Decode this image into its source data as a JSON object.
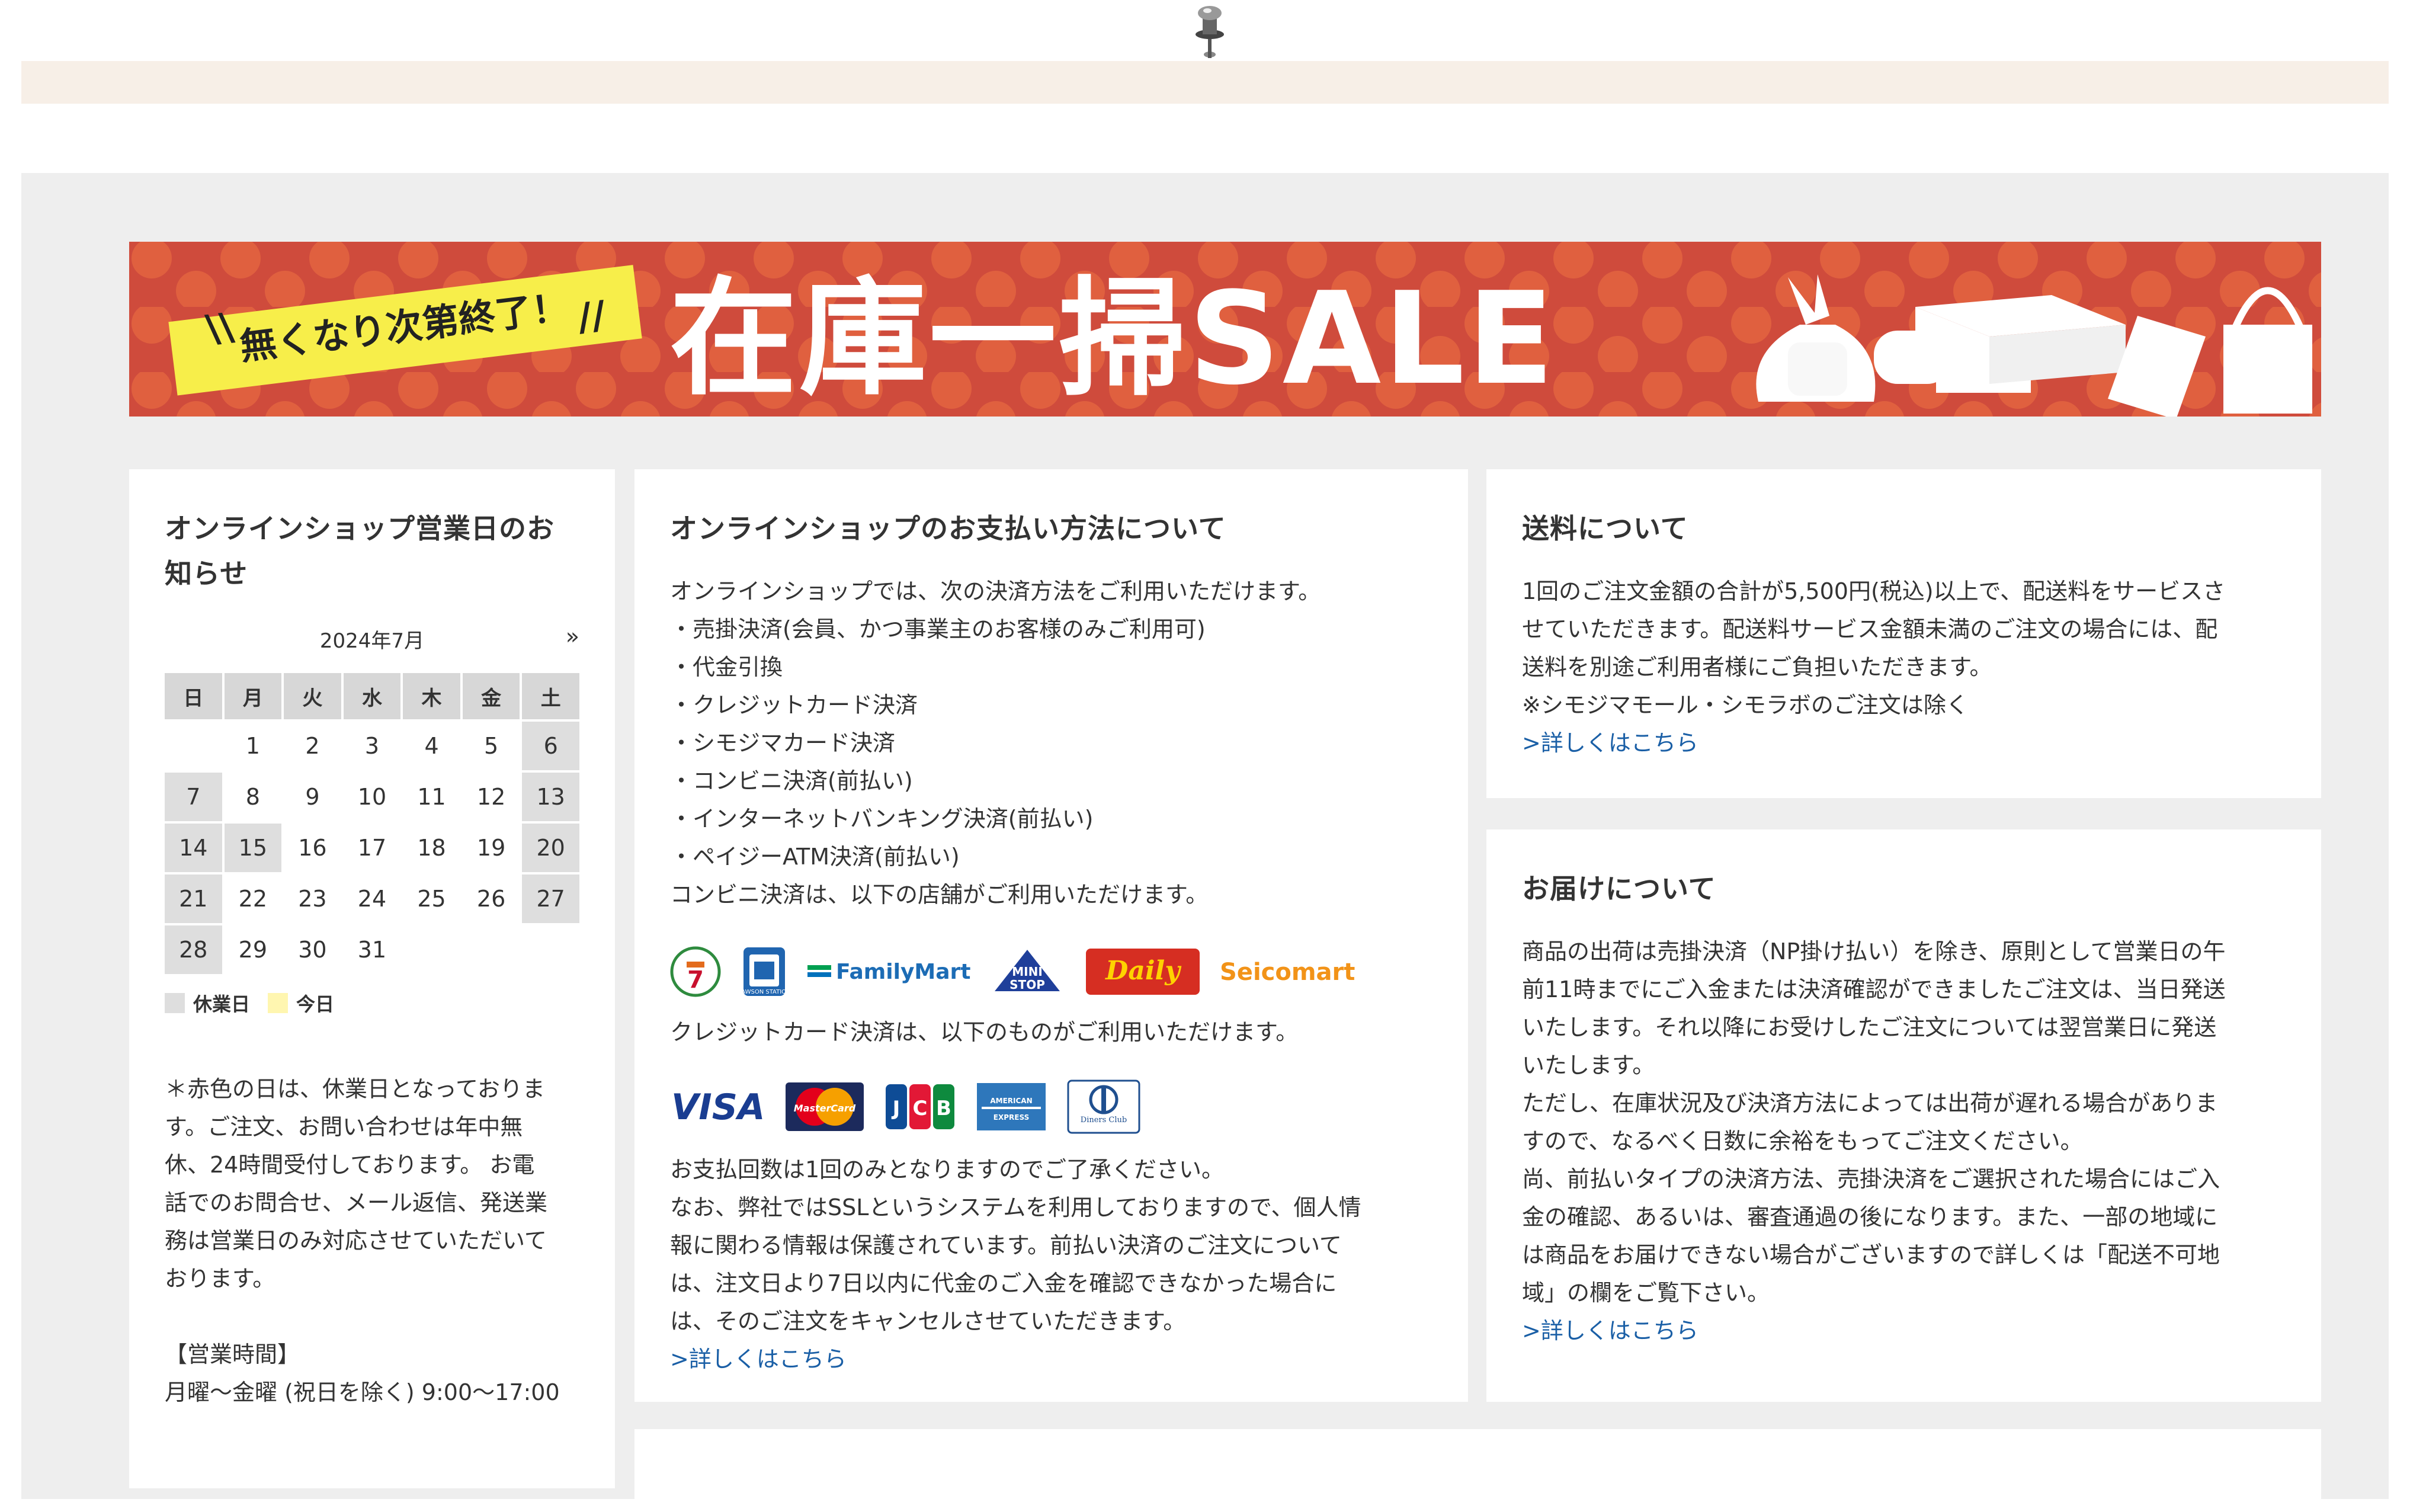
{
  "banner": {
    "tag_text": "無くなり次第終了！",
    "title": "在庫一掃SALE",
    "colors": {
      "background": "#cf4b3c",
      "dots": "#e0603f",
      "tag": "#f7ee4a"
    }
  },
  "calendar_card": {
    "title": "オンラインショップ営業日のお知らせ",
    "month": "2024年7月",
    "next": "»",
    "weekdays": [
      "日",
      "月",
      "火",
      "水",
      "木",
      "金",
      "土"
    ],
    "weeks": [
      [
        {
          "d": "",
          "off": false
        },
        {
          "d": "1",
          "off": false
        },
        {
          "d": "2",
          "off": false
        },
        {
          "d": "3",
          "off": false
        },
        {
          "d": "4",
          "off": false
        },
        {
          "d": "5",
          "off": false
        },
        {
          "d": "6",
          "off": true
        }
      ],
      [
        {
          "d": "7",
          "off": true
        },
        {
          "d": "8",
          "off": false
        },
        {
          "d": "9",
          "off": false
        },
        {
          "d": "10",
          "off": false
        },
        {
          "d": "11",
          "off": false
        },
        {
          "d": "12",
          "off": false
        },
        {
          "d": "13",
          "off": true
        }
      ],
      [
        {
          "d": "14",
          "off": true
        },
        {
          "d": "15",
          "off": true
        },
        {
          "d": "16",
          "off": false
        },
        {
          "d": "17",
          "off": false
        },
        {
          "d": "18",
          "off": false
        },
        {
          "d": "19",
          "off": false
        },
        {
          "d": "20",
          "off": true
        }
      ],
      [
        {
          "d": "21",
          "off": true
        },
        {
          "d": "22",
          "off": false
        },
        {
          "d": "23",
          "off": false
        },
        {
          "d": "24",
          "off": false
        },
        {
          "d": "25",
          "off": false
        },
        {
          "d": "26",
          "off": false
        },
        {
          "d": "27",
          "off": true
        }
      ],
      [
        {
          "d": "28",
          "off": true
        },
        {
          "d": "29",
          "off": false
        },
        {
          "d": "30",
          "off": false
        },
        {
          "d": "31",
          "off": false
        },
        {
          "d": "",
          "off": false
        },
        {
          "d": "",
          "off": false
        },
        {
          "d": "",
          "off": false
        }
      ]
    ],
    "legend_holiday": "休業日",
    "legend_today": "今日",
    "note_lines": [
      "＊赤色の日は、休業日となっておりま",
      "す。ご注文、お問い合わせは年中無",
      "休、24時間受付しております。 お電",
      "話でのお問合せ、メール返信、発送業",
      "務は営業日のみ対応させていただいて",
      "おります。"
    ],
    "hours_label": "【営業時間】",
    "hours_text": "月曜〜金曜 (祝日を除く) 9:00〜17:00"
  },
  "payment_card": {
    "title": "オンラインショップのお支払い方法について",
    "intro_lines": [
      "オンラインショップでは、次の決済方法をご利用いただけます。",
      "・売掛決済(会員、かつ事業主のお客様のみご利用可)",
      "・代金引換",
      "・クレジットカード決済",
      "・シモジマカード決済",
      "・コンビニ決済(前払い)",
      "・インターネットバンキング決済(前払い)",
      "・ペイジーATM決済(前払い)",
      "コンビニ決済は、以下の店舗がご利用いただけます。"
    ],
    "store_logos": [
      "7-Eleven",
      "LAWSON STATION",
      "FamilyMart",
      "MINI STOP",
      "Daily YAMAZAKI",
      "Seicomart"
    ],
    "credit_line": "クレジットカード決済は、以下のものがご利用いただけます。",
    "card_logos": [
      "VISA",
      "MasterCard",
      "JCB",
      "AMERICAN EXPRESS",
      "Diners Club INTERNATIONAL"
    ],
    "footer_lines": [
      "お支払回数は1回のみとなりますのでご了承ください。",
      "なお、弊社ではSSLというシステムを利用しておりますので、個人情",
      "報に関わる情報は保護されています。前払い決済のご注文について",
      "は、注文日より7日以内に代金のご入金を確認できなかった場合に",
      "は、そのご注文をキャンセルさせていただきます。"
    ],
    "link": ">詳しくはこちら"
  },
  "shipping_card": {
    "title": "送料について",
    "lines": [
      "1回のご注文金額の合計が5,500円(税込)以上で、配送料をサービスさ",
      "せていただきます。配送料サービス金額未満のご注文の場合には、配",
      "送料を別途ご利用者様にご負担いただきます。",
      "※シモジマモール・シモラボのご注文は除く"
    ],
    "link": ">詳しくはこちら"
  },
  "delivery_card": {
    "title": "お届けについて",
    "lines": [
      "商品の出荷は売掛決済（NP掛け払い）を除き、原則として営業日の午",
      "前11時までにご入金または決済確認ができましたご注文は、当日発送",
      "いたします。それ以降にお受けしたご注文については翌営業日に発送",
      "いたします。",
      "ただし、在庫状況及び決済方法によっては出荷が遅れる場合がありま",
      "すので、なるべく日数に余裕をもってご注文ください。",
      "尚、前払いタイプの決済方法、売掛決済をご選択された場合にはご入",
      "金の確認、あるいは、審査通過の後になります。また、一部の地域に",
      "は商品をお届けできない場合がございますので詳しくは「配送不可地",
      "域」の欄をご覧下さい。"
    ],
    "link": ">詳しくはこちら"
  }
}
